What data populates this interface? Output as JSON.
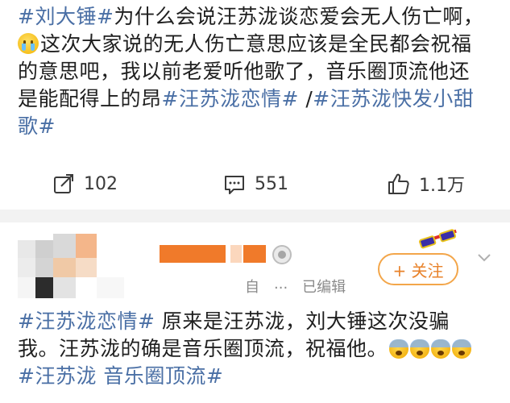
{
  "post1": {
    "line1": [
      {
        "type": "tag",
        "text": "#刘大锤#"
      },
      {
        "type": "text",
        "text": "为什么会说汪苏泷谈恋爱会无人伤亡啊，"
      }
    ],
    "line2": "这次大家说的无人伤亡意思应该是全民都会祝福",
    "line3": "的意思吧，我以前老爱听他歌了，音乐圈顶流他还",
    "line4_text": "是能配得上的昂",
    "line4_tag1": "#汪苏泷恋情#",
    "line4_sep": " /",
    "line4_tag2": "#汪苏泷快发小甜",
    "line5_tag": "歌#",
    "emoji": "crying-face-emoji"
  },
  "actions": {
    "repost_count": "102",
    "comment_count": "551",
    "like_count": "1.1万"
  },
  "post2": {
    "meta_prefix": "自",
    "meta_ellipsis": "...",
    "meta_status": "已编辑",
    "follow_label": "+ 关注",
    "line1_tag": "#汪苏泷恋情#",
    "line1_text": " 原来是汪苏泷，刘大锤这次没骗",
    "line2_text": "我。汪苏泷的确是音乐圈顶流，祝福他。",
    "line3_tag": "#汪苏泷 音乐圈顶流#",
    "emoji_name": "fearful-face-emoji",
    "emoji_count": 4
  },
  "colors": {
    "tag": "#4a6fa5",
    "follow": "#e8822a",
    "divider": "#f2f2f2"
  }
}
